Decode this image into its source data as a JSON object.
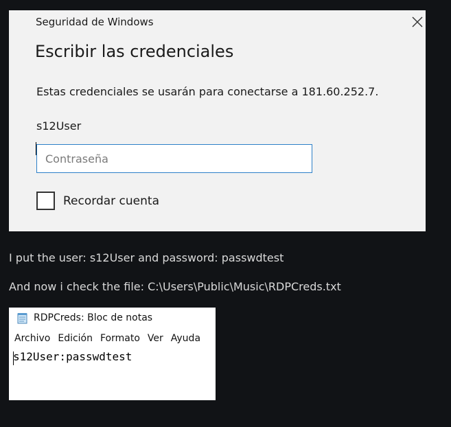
{
  "dialog": {
    "window_title": "Seguridad de Windows",
    "heading": "Escribir las credenciales",
    "message": "Estas credenciales se usarán para conectarse a 181.60.252.7.",
    "username": "s12User",
    "password_placeholder": "Contraseña",
    "password_value": "",
    "remember_label": "Recordar cuenta",
    "remember_checked": false,
    "close_icon": "close-icon"
  },
  "post": {
    "line1": "I put the user: s12User and password: passwdtest",
    "line2": "And now i check the file:  C:\\Users\\Public\\Music\\RDPCreds.txt"
  },
  "notepad": {
    "title": "RDPCreds: Bloc de notas",
    "app_icon": "notepad-icon",
    "menu": [
      "Archivo",
      "Edición",
      "Formato",
      "Ver",
      "Ayuda"
    ],
    "content": "s12User:passwdtest"
  },
  "colors": {
    "page_background": "#111316",
    "dialog_background": "#f2f2f2",
    "input_border": "#2c7fc8",
    "post_text": "#d9d9d9"
  }
}
